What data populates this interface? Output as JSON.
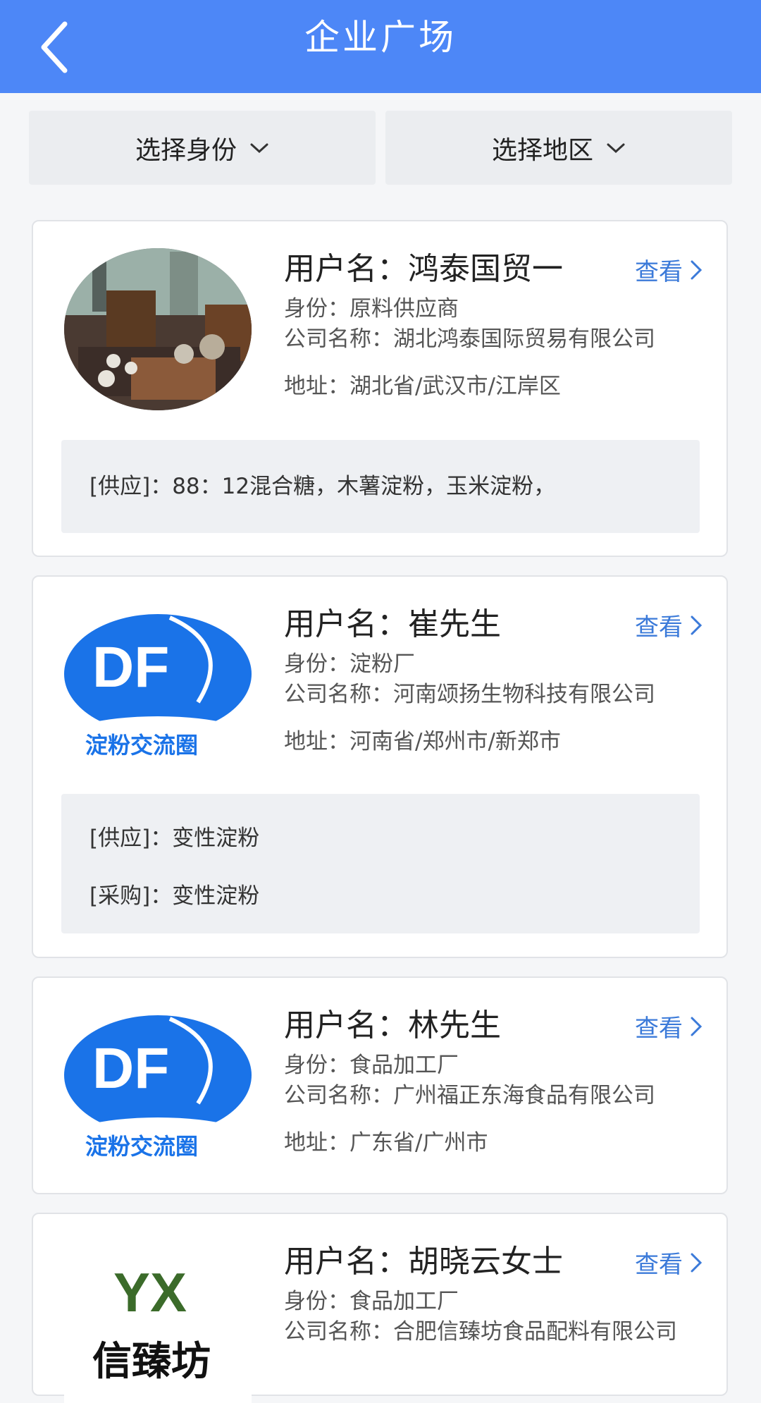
{
  "header": {
    "title": "企业广场"
  },
  "filters": {
    "identity_label": "选择身份",
    "region_label": "选择地区"
  },
  "cards": [
    {
      "username": "用户名：鸿泰国贸一",
      "identity": "身份：原料供应商",
      "company": "公司名称：湖北鸿泰国际贸易有限公司",
      "address": "地址：湖北省/武汉市/江岸区",
      "view_label": "查看",
      "supply": "[供应]：88：12混合糖，木薯淀粉，玉米淀粉，"
    },
    {
      "username": "用户名：崔先生",
      "identity": "身份：淀粉厂",
      "company": "公司名称：河南颂扬生物科技有限公司",
      "address": "地址：河南省/郑州市/新郑市",
      "view_label": "查看",
      "supply": "[供应]：变性淀粉",
      "purchase": "[采购]：变性淀粉",
      "logo_text": "DF",
      "logo_caption": "淀粉交流圈"
    },
    {
      "username": "用户名：林先生",
      "identity": "身份：食品加工厂",
      "company": "公司名称：广州福正东海食品有限公司",
      "address": "地址：广东省/广州市",
      "view_label": "查看",
      "logo_text": "DF",
      "logo_caption": "淀粉交流圈"
    },
    {
      "username": "用户名：胡晓云女士",
      "identity": "身份：食品加工厂",
      "company": "公司名称：合肥信臻坊食品配料有限公司",
      "view_label": "查看",
      "logo_text": "YX",
      "logo_caption": "信臻坊"
    }
  ]
}
